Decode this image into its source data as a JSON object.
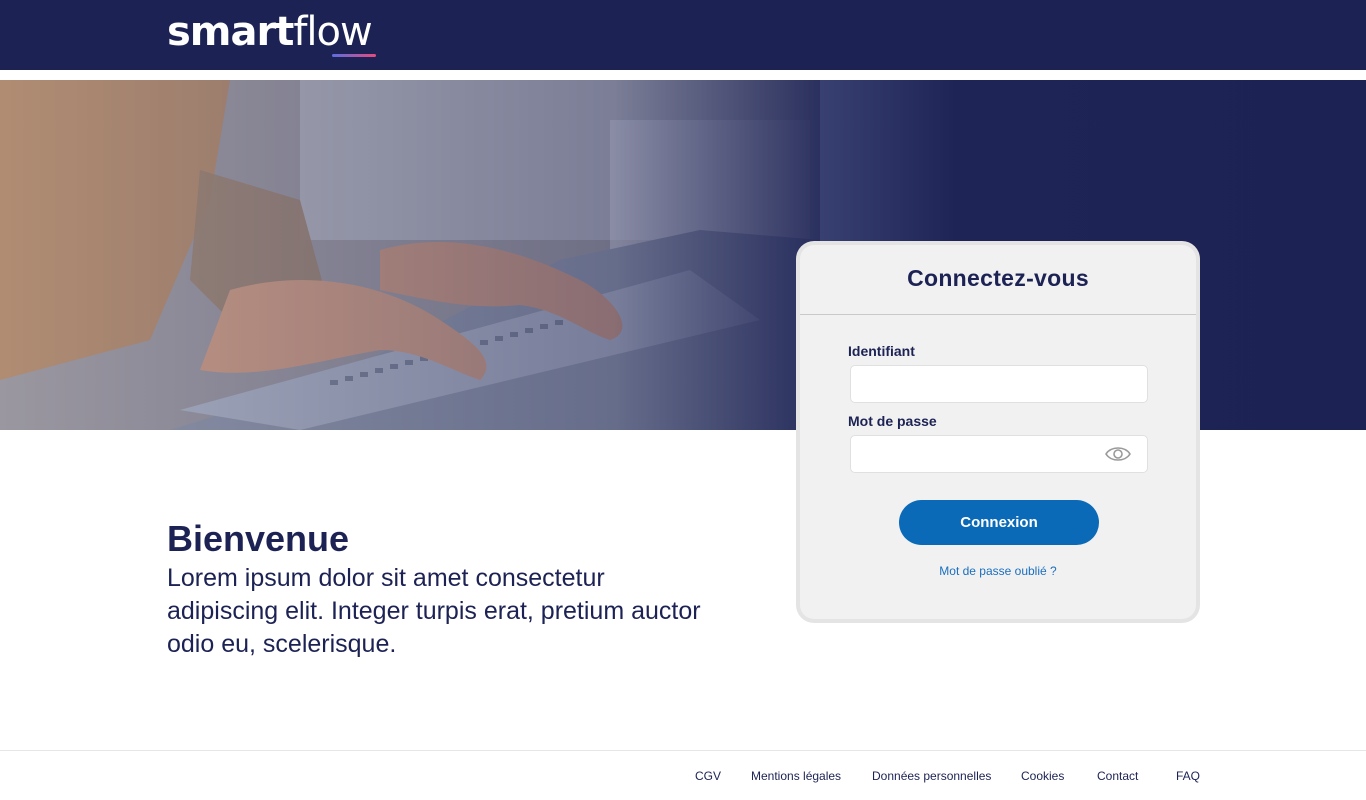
{
  "header": {
    "logo_bold": "smart",
    "logo_light": "flow"
  },
  "login": {
    "title": "Connectez-vous",
    "username_label": "Identifiant",
    "username_value": "",
    "password_label": "Mot de passe",
    "password_value": "",
    "submit_label": "Connexion",
    "forgot_label": "Mot de passe oublié ?"
  },
  "welcome": {
    "title": "Bienvenue",
    "text": "Lorem ipsum dolor sit amet consectetur adipiscing elit. Integer turpis erat, pretium auctor odio eu, scelerisque."
  },
  "footer": {
    "links": [
      "CGV",
      "Mentions légales",
      "Données personnelles",
      "Cookies",
      "Contact",
      "FAQ"
    ]
  },
  "colors": {
    "navy": "#1c2254",
    "button_blue": "#0a6ab7",
    "link_blue": "#1a6fbf",
    "card_bg": "#f1f1f1"
  },
  "icons": {
    "password_toggle": "eye-icon"
  }
}
